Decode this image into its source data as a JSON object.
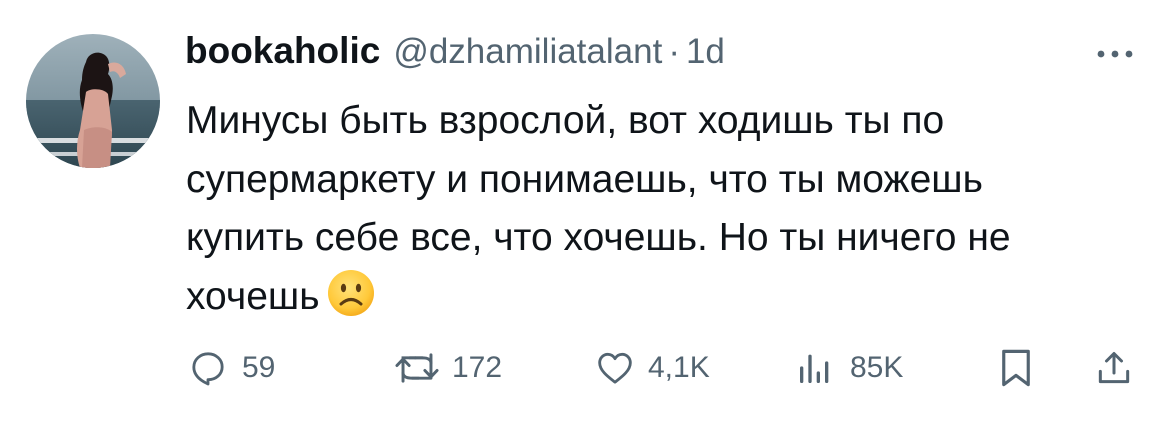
{
  "tweet": {
    "display_name": "bookaholic",
    "handle": "@dzhamiliatalant",
    "separator": "·",
    "time": "1d",
    "text_lines": [
      "Минусы быть взрослой, вот ходишь ты по",
      "супермаркету и понимаешь, что ты можешь",
      "купить себе все, что хочешь. Но ты ничего не",
      "хочешь"
    ],
    "emoji": "slightly-frowning-face-emoji"
  },
  "actions": {
    "replies": "59",
    "reposts": "172",
    "likes": "4,1K",
    "views": "85K"
  },
  "icons": {
    "more": "more-horizontal-icon",
    "reply": "reply-icon",
    "repost": "repost-icon",
    "like": "heart-icon",
    "views": "analytics-icon",
    "bookmark": "bookmark-icon",
    "share": "share-icon"
  },
  "colors": {
    "text_primary": "#0f1419",
    "text_secondary": "#536471",
    "background": "#ffffff"
  }
}
